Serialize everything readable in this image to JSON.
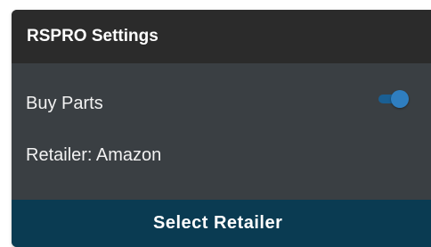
{
  "panel": {
    "title": "RSPRO Settings"
  },
  "settings": {
    "buy_parts_label": "Buy Parts",
    "buy_parts_enabled": true,
    "retailer_text": "Retailer: Amazon"
  },
  "footer": {
    "select_retailer_label": "Select Retailer"
  },
  "colors": {
    "header_bg": "#2b2b2b",
    "panel_bg": "#3a3f43",
    "toggle_on": "#2f7ec0",
    "button_bg": "#0a3b52"
  }
}
